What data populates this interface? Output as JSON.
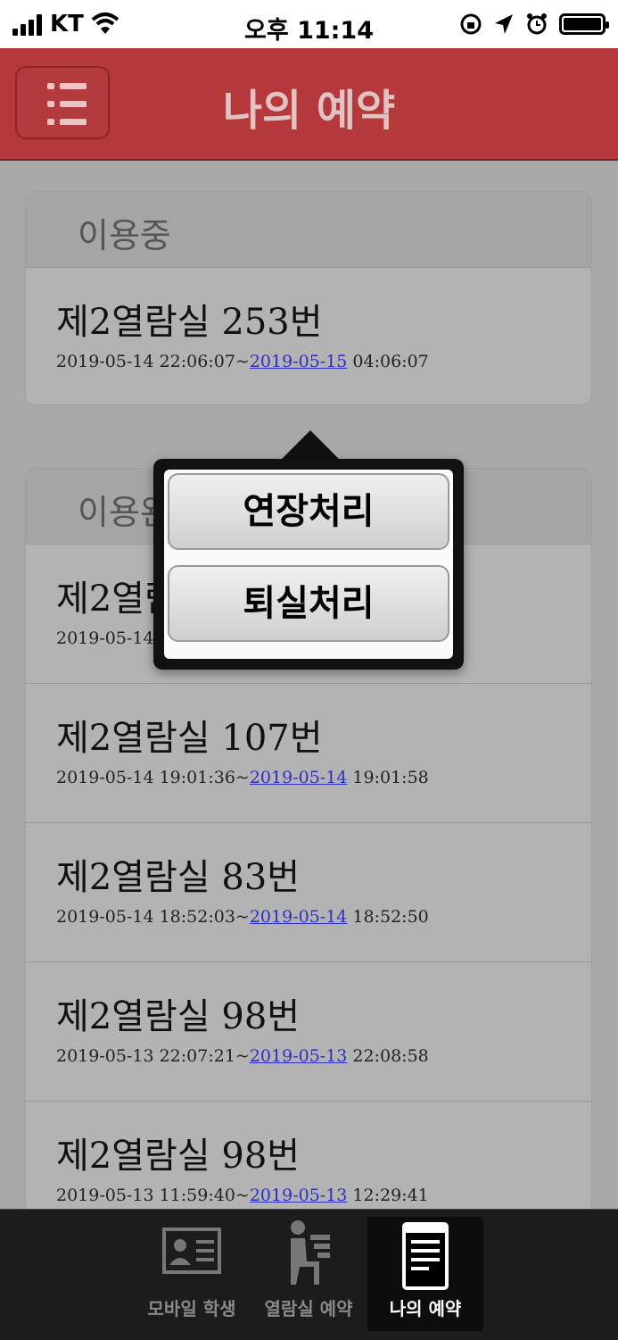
{
  "status_bar": {
    "carrier": "KT",
    "time": "오후 11:14"
  },
  "header": {
    "title": "나의 예약"
  },
  "in_use": {
    "title": "이용중",
    "items": [
      {
        "name": "제2열람실 253번",
        "start": "2019-05-14 22:06:07~",
        "end_date": "2019-05-15",
        "end_time": " 04:06:07"
      }
    ]
  },
  "completed": {
    "title": "이용완",
    "items": [
      {
        "name": "제2열람",
        "start": "2019-05-14 2",
        "end_date": "",
        "end_time": ""
      },
      {
        "name": "제2열람실 107번",
        "start": "2019-05-14 19:01:36~",
        "end_date": "2019-05-14",
        "end_time": " 19:01:58"
      },
      {
        "name": "제2열람실 83번",
        "start": "2019-05-14 18:52:03~",
        "end_date": "2019-05-14",
        "end_time": " 18:52:50"
      },
      {
        "name": "제2열람실 98번",
        "start": "2019-05-13 22:07:21~",
        "end_date": "2019-05-13",
        "end_time": " 22:08:58"
      },
      {
        "name": "제2열람실 98번",
        "start": "2019-05-13 11:59:40~",
        "end_date": "2019-05-13",
        "end_time": " 12:29:41"
      }
    ]
  },
  "popover": {
    "extend_label": "연장처리",
    "checkout_label": "퇴실처리"
  },
  "tabbar": {
    "tabs": [
      {
        "label": "모바일 학생",
        "icon": "id-card-icon"
      },
      {
        "label": "열람실 예약",
        "icon": "seat-icon"
      },
      {
        "label": "나의 예약",
        "icon": "document-icon"
      }
    ]
  },
  "colors": {
    "header": "#b5383b",
    "link": "#2d2dc8"
  }
}
